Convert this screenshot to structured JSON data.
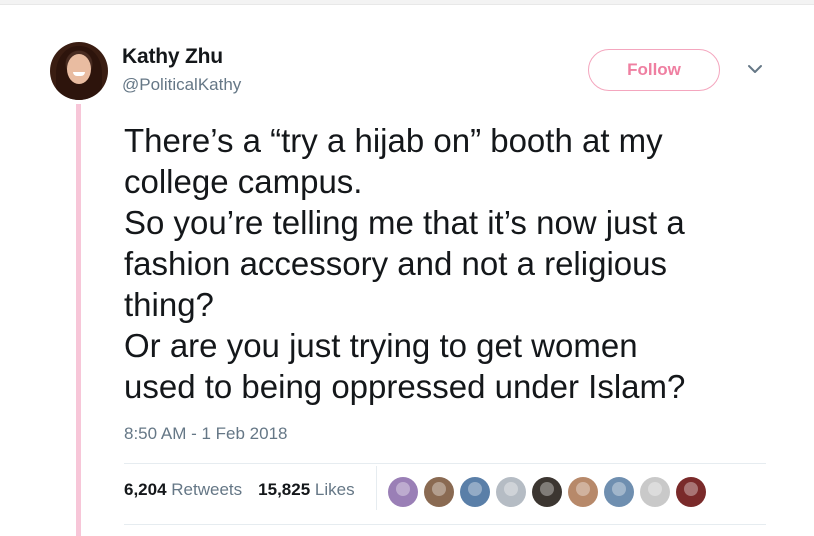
{
  "author": {
    "name": "Kathy Zhu",
    "handle": "@PoliticalKathy"
  },
  "follow_button": "Follow",
  "tweet": {
    "lines": [
      "There’s a “try a hijab on” booth at my",
      "college campus.",
      "So you’re telling me that it’s now just a",
      "fashion accessory and not a religious",
      "thing?",
      "Or are you just trying to get women",
      "used to being oppressed under Islam?"
    ]
  },
  "timestamp": "8:50 AM - 1 Feb 2018",
  "stats": {
    "retweets_count": "6,204",
    "retweets_label": "Retweets",
    "likes_count": "15,825",
    "likes_label": "Likes"
  },
  "likers": [
    {
      "color": "#9a7fb6"
    },
    {
      "color": "#8a6a52"
    },
    {
      "color": "#5a7fa8"
    },
    {
      "color": "#b5bcc4"
    },
    {
      "color": "#3c3631"
    },
    {
      "color": "#b7896a"
    },
    {
      "color": "#6f8fb0"
    },
    {
      "color": "#c9c9c9"
    },
    {
      "color": "#7a2a2a"
    }
  ],
  "colors": {
    "accent_pink": "#ef7fa1",
    "thread_line": "#f7c6d8",
    "text_primary": "#14171a",
    "text_secondary": "#657786"
  }
}
